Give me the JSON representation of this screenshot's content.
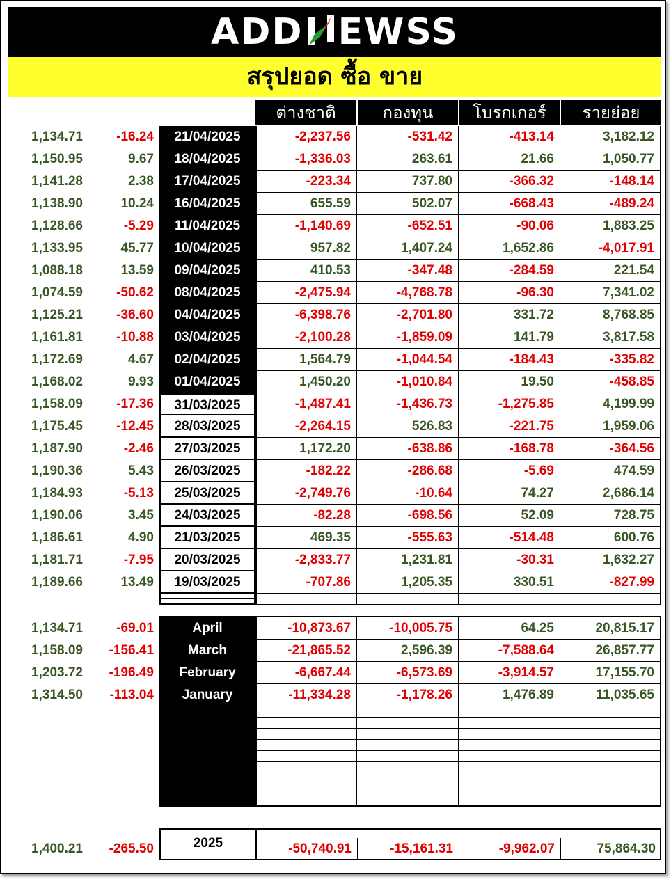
{
  "brand": {
    "left": "ADD",
    "right": "EWSS",
    "mark": "N"
  },
  "title": "สรุปยอด ซื้อ ขาย",
  "columns": [
    "ต่างชาติ",
    "กองทุน",
    "โบรกเกอร์",
    "รายย่อย"
  ],
  "daily_rows": [
    {
      "index": "1,134.71",
      "change": "-16.24",
      "date": "21/04/2025",
      "foreign": "-2,237.56",
      "fund": "-531.42",
      "broker": "-413.14",
      "retail": "3,182.12"
    },
    {
      "index": "1,150.95",
      "change": "9.67",
      "date": "18/04/2025",
      "foreign": "-1,336.03",
      "fund": "263.61",
      "broker": "21.66",
      "retail": "1,050.77"
    },
    {
      "index": "1,141.28",
      "change": "2.38",
      "date": "17/04/2025",
      "foreign": "-223.34",
      "fund": "737.80",
      "broker": "-366.32",
      "retail": "-148.14"
    },
    {
      "index": "1,138.90",
      "change": "10.24",
      "date": "16/04/2025",
      "foreign": "655.59",
      "fund": "502.07",
      "broker": "-668.43",
      "retail": "-489.24"
    },
    {
      "index": "1,128.66",
      "change": "-5.29",
      "date": "11/04/2025",
      "foreign": "-1,140.69",
      "fund": "-652.51",
      "broker": "-90.06",
      "retail": "1,883.25"
    },
    {
      "index": "1,133.95",
      "change": "45.77",
      "date": "10/04/2025",
      "foreign": "957.82",
      "fund": "1,407.24",
      "broker": "1,652.86",
      "retail": "-4,017.91"
    },
    {
      "index": "1,088.18",
      "change": "13.59",
      "date": "09/04/2025",
      "foreign": "410.53",
      "fund": "-347.48",
      "broker": "-284.59",
      "retail": "221.54"
    },
    {
      "index": "1,074.59",
      "change": "-50.62",
      "date": "08/04/2025",
      "foreign": "-2,475.94",
      "fund": "-4,768.78",
      "broker": "-96.30",
      "retail": "7,341.02"
    },
    {
      "index": "1,125.21",
      "change": "-36.60",
      "date": "04/04/2025",
      "foreign": "-6,398.76",
      "fund": "-2,701.80",
      "broker": "331.72",
      "retail": "8,768.85"
    },
    {
      "index": "1,161.81",
      "change": "-10.88",
      "date": "03/04/2025",
      "foreign": "-2,100.28",
      "fund": "-1,859.09",
      "broker": "141.79",
      "retail": "3,817.58"
    },
    {
      "index": "1,172.69",
      "change": "4.67",
      "date": "02/04/2025",
      "foreign": "1,564.79",
      "fund": "-1,044.54",
      "broker": "-184.43",
      "retail": "-335.82"
    },
    {
      "index": "1,168.02",
      "change": "9.93",
      "date": "01/04/2025",
      "foreign": "1,450.20",
      "fund": "-1,010.84",
      "broker": "19.50",
      "retail": "-458.85"
    },
    {
      "index": "1,158.09",
      "change": "-17.36",
      "date": "31/03/2025",
      "foreign": "-1,487.41",
      "fund": "-1,436.73",
      "broker": "-1,275.85",
      "retail": "4,199.99"
    },
    {
      "index": "1,175.45",
      "change": "-12.45",
      "date": "28/03/2025",
      "foreign": "-2,264.15",
      "fund": "526.83",
      "broker": "-221.75",
      "retail": "1,959.06"
    },
    {
      "index": "1,187.90",
      "change": "-2.46",
      "date": "27/03/2025",
      "foreign": "1,172.20",
      "fund": "-638.86",
      "broker": "-168.78",
      "retail": "-364.56"
    },
    {
      "index": "1,190.36",
      "change": "5.43",
      "date": "26/03/2025",
      "foreign": "-182.22",
      "fund": "-286.68",
      "broker": "-5.69",
      "retail": "474.59"
    },
    {
      "index": "1,184.93",
      "change": "-5.13",
      "date": "25/03/2025",
      "foreign": "-2,749.76",
      "fund": "-10.64",
      "broker": "74.27",
      "retail": "2,686.14"
    },
    {
      "index": "1,190.06",
      "change": "3.45",
      "date": "24/03/2025",
      "foreign": "-82.28",
      "fund": "-698.56",
      "broker": "52.09",
      "retail": "728.75"
    },
    {
      "index": "1,186.61",
      "change": "4.90",
      "date": "21/03/2025",
      "foreign": "469.35",
      "fund": "-555.63",
      "broker": "-514.48",
      "retail": "600.76"
    },
    {
      "index": "1,181.71",
      "change": "-7.95",
      "date": "20/03/2025",
      "foreign": "-2,833.77",
      "fund": "1,231.81",
      "broker": "-30.31",
      "retail": "1,632.27"
    },
    {
      "index": "1,189.66",
      "change": "13.49",
      "date": "19/03/2025",
      "foreign": "-707.86",
      "fund": "1,205.35",
      "broker": "330.51",
      "retail": "-827.99"
    }
  ],
  "monthly_rows": [
    {
      "index": "1,134.71",
      "change": "-69.01",
      "month": "April",
      "foreign": "-10,873.67",
      "fund": "-10,005.75",
      "broker": "64.25",
      "retail": "20,815.17"
    },
    {
      "index": "1,158.09",
      "change": "-156.41",
      "month": "March",
      "foreign": "-21,865.52",
      "fund": "2,596.39",
      "broker": "-7,588.64",
      "retail": "26,857.77"
    },
    {
      "index": "1,203.72",
      "change": "-196.49",
      "month": "February",
      "foreign": "-6,667.44",
      "fund": "-6,573.69",
      "broker": "-3,914.57",
      "retail": "17,155.70"
    },
    {
      "index": "1,314.50",
      "change": "-113.04",
      "month": "January",
      "foreign": "-11,334.28",
      "fund": "-1,178.26",
      "broker": "1,476.89",
      "retail": "11,035.65"
    }
  ],
  "yearly": {
    "index": "1,400.21",
    "change": "-265.50",
    "year": "2025",
    "foreign": "-50,740.91",
    "fund": "-15,161.31",
    "broker": "-9,962.07",
    "retail": "75,864.30"
  },
  "colors": {
    "positive": "#375623",
    "negative": "#e00000",
    "banner": "#000000",
    "highlight": "#ffff2e",
    "logo_mark_green": "#1f9e2f",
    "logo_mark_red": "#d61e1e"
  }
}
